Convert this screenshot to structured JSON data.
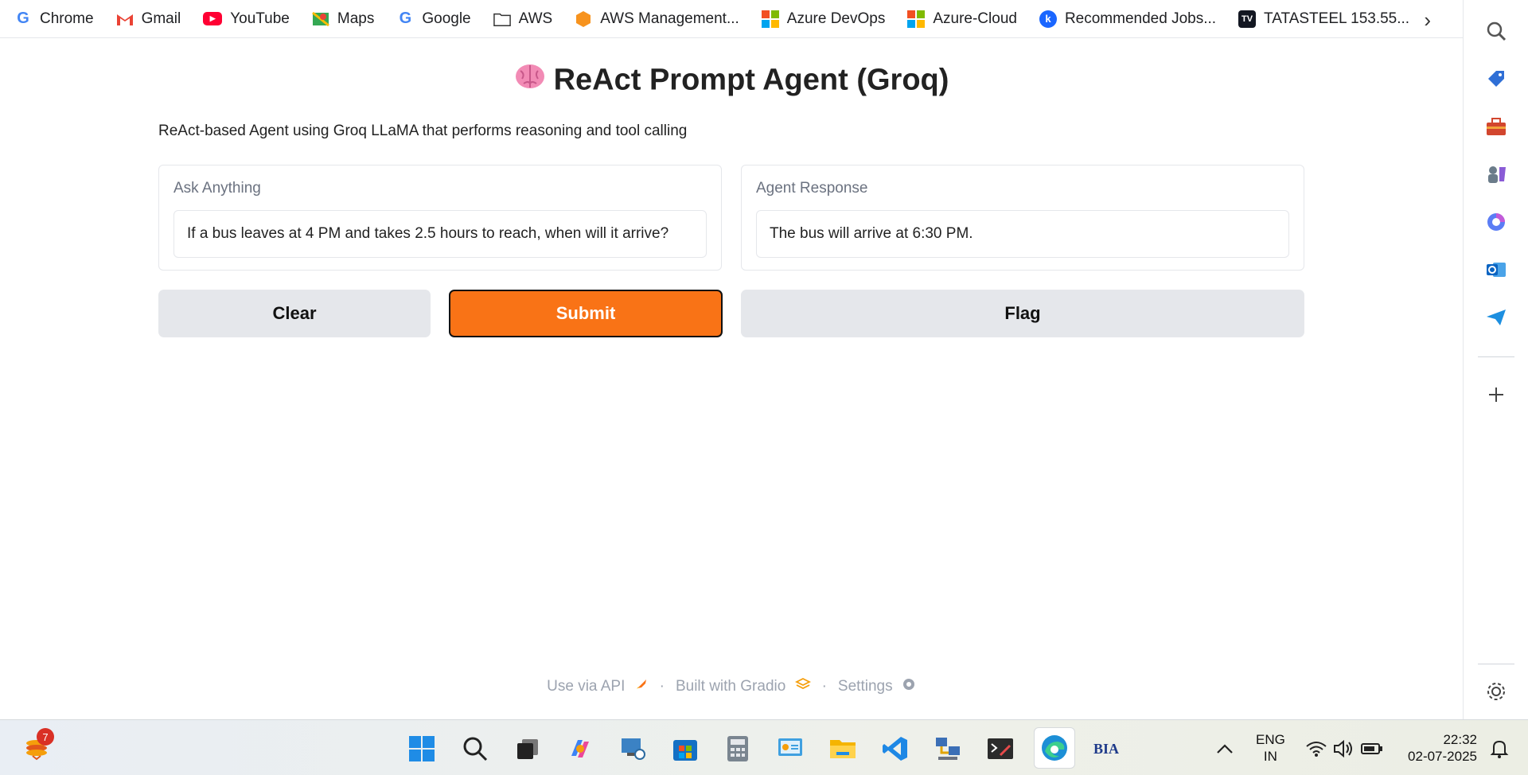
{
  "bookmarks": [
    {
      "label": "Chrome",
      "icon": "google-g-icon"
    },
    {
      "label": "Gmail",
      "icon": "gmail-icon"
    },
    {
      "label": "YouTube",
      "icon": "youtube-icon"
    },
    {
      "label": "Maps",
      "icon": "maps-icon"
    },
    {
      "label": "Google",
      "icon": "google-g-icon"
    },
    {
      "label": "AWS",
      "icon": "folder-icon"
    },
    {
      "label": "AWS Management...",
      "icon": "aws-icon"
    },
    {
      "label": "Azure DevOps",
      "icon": "microsoft-icon"
    },
    {
      "label": "Azure-Cloud",
      "icon": "microsoft-icon"
    },
    {
      "label": "Recommended Jobs...",
      "icon": "jobs-icon"
    },
    {
      "label": "TATASTEEL 153.55...",
      "icon": "tradingview-icon"
    }
  ],
  "app": {
    "title": "ReAct Prompt Agent (Groq)",
    "description": "ReAct-based Agent using Groq LLaMA that performs reasoning and tool calling",
    "input_label": "Ask Anything",
    "input_value": "If a bus leaves at 4 PM and takes 2.5 hours to reach, when will it arrive?",
    "output_label": "Agent Response",
    "output_value": "The bus will arrive at 6:30 PM.",
    "clear_label": "Clear",
    "submit_label": "Submit",
    "flag_label": "Flag"
  },
  "footer": {
    "api": "Use via API",
    "built": "Built with Gradio",
    "settings": "Settings",
    "separator": "·"
  },
  "taskbar": {
    "notification_count": "7",
    "lang_top": "ENG",
    "lang_bottom": "IN",
    "time": "22:32",
    "date": "02-07-2025",
    "bia_label": "BIA"
  },
  "colors": {
    "accent": "#f97316",
    "secondary_button": "#e5e7eb"
  }
}
